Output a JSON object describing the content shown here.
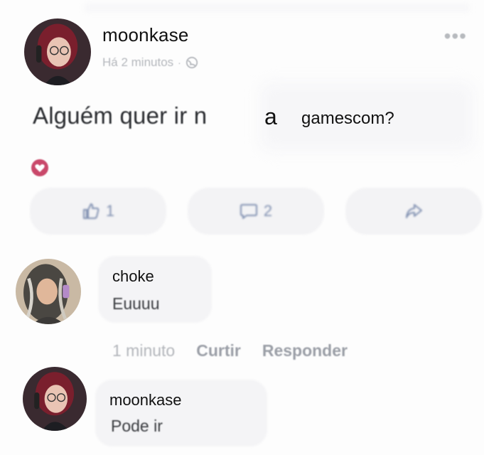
{
  "post": {
    "author": "moonkase",
    "meta_time": "Há 2 minutos",
    "meta_separator": "·",
    "text_blurred": "Alguém quer ir n",
    "text_letter": "a",
    "text_word": "gamescom?",
    "reaction_icon": "heart-reaction-icon",
    "more_icon": "more-options-icon",
    "privacy_icon": "globe-icon",
    "actions": {
      "like_count": "1",
      "comment_count": "2"
    }
  },
  "comments": [
    {
      "author": "choke",
      "text": "Euuuu",
      "time": "1 minuto",
      "like_label": "Curtir",
      "reply_label": "Responder"
    },
    {
      "author": "moonkase",
      "text": "Pode ir"
    }
  ],
  "colors": {
    "accent_blue": "#7f8fb0",
    "reaction": "#c9486a",
    "bubble": "#f4f4f6"
  }
}
